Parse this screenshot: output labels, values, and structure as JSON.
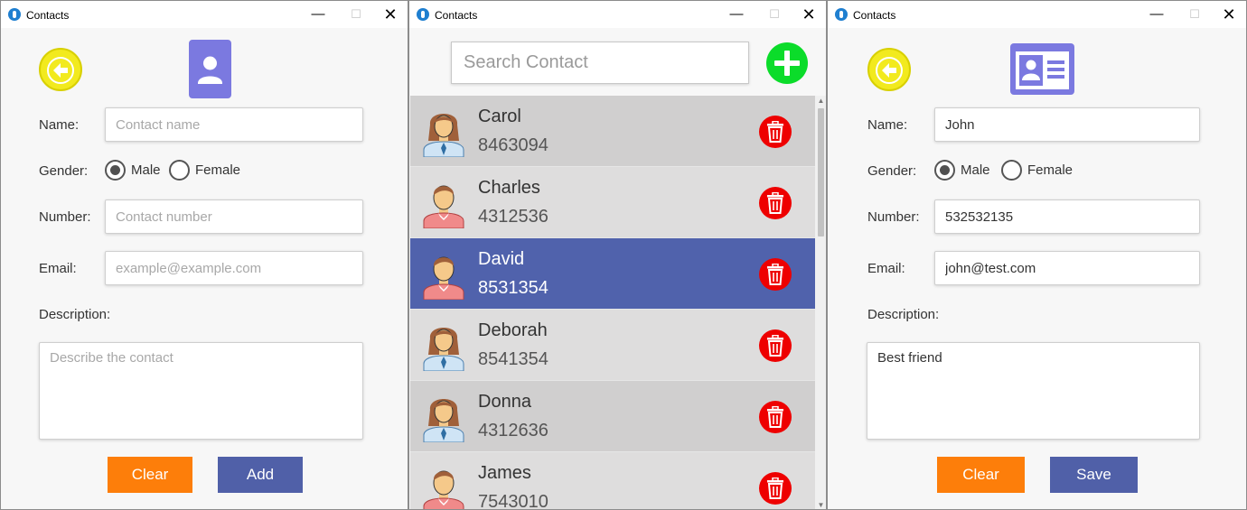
{
  "add_window": {
    "title": "Contacts",
    "labels": {
      "name": "Name:",
      "gender": "Gender:",
      "number": "Number:",
      "email": "Email:",
      "description": "Description:"
    },
    "placeholders": {
      "name": "Contact name",
      "number": "Contact number",
      "email": "example@example.com",
      "description": "Describe the contact"
    },
    "gender_options": [
      "Male",
      "Female"
    ],
    "selected_gender": "Male",
    "buttons": {
      "clear": "Clear",
      "add": "Add"
    }
  },
  "list_window": {
    "title": "Contacts",
    "search_placeholder": "Search Contact",
    "contacts": [
      {
        "name": "Carol",
        "number": "8463094",
        "gender": "female"
      },
      {
        "name": "Charles",
        "number": "4312536",
        "gender": "male"
      },
      {
        "name": "David",
        "number": "8531354",
        "gender": "male",
        "selected": true
      },
      {
        "name": "Deborah",
        "number": "8541354",
        "gender": "female"
      },
      {
        "name": "Donna",
        "number": "4312636",
        "gender": "female"
      },
      {
        "name": "James",
        "number": "7543010",
        "gender": "male"
      }
    ]
  },
  "edit_window": {
    "title": "Contacts",
    "labels": {
      "name": "Name:",
      "gender": "Gender:",
      "number": "Number:",
      "email": "Email:",
      "description": "Description:"
    },
    "values": {
      "name": "John",
      "number": "532532135",
      "email": "john@test.com",
      "description": "Best friend"
    },
    "gender_options": [
      "Male",
      "Female"
    ],
    "selected_gender": "Male",
    "buttons": {
      "clear": "Clear",
      "save": "Save"
    }
  },
  "window_controls": {
    "minimize": "—",
    "maximize": "☐",
    "close": "✕"
  },
  "colors": {
    "back_button": "#f2ea1e",
    "contact_icon": "#7b79e0",
    "add_button": "#0bdc2a",
    "delete_button": "#ee0000",
    "selected_row": "#5062ac",
    "clear_button": "#fd7e0a",
    "primary_button": "#5060a8"
  },
  "icons": {
    "back": "arrow-left-icon",
    "new_contact": "person-icon",
    "edit_contact": "id-card-icon",
    "add": "plus-icon",
    "delete": "trash-icon",
    "avatar_female": "woman-avatar-icon",
    "avatar_male": "man-avatar-icon"
  }
}
